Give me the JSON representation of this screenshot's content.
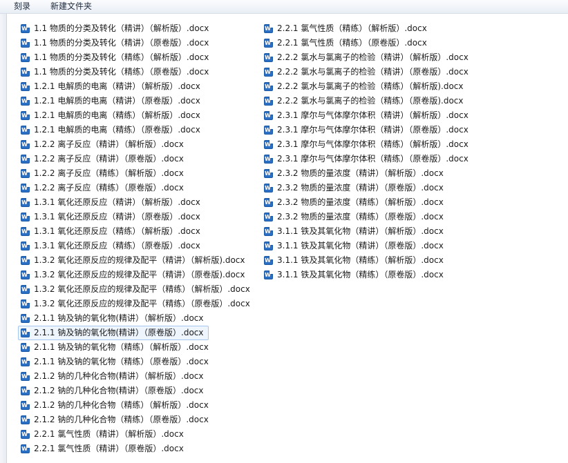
{
  "toolbar": {
    "burn_label": "刻录",
    "new_folder_label": "新建文件夹"
  },
  "icon": {
    "glyph": "W",
    "name": "word-doc-icon",
    "color": "#2b6fc4"
  },
  "selected_file": "2.1.1 钠及钠的氧化物(精讲）（原卷版）.docx",
  "columns": [
    [
      "1.1 物质的分类及转化（精讲）（解析版）.docx",
      "1.1 物质的分类及转化（精讲）（原卷版）.docx",
      "1.1 物质的分类及转化（精练）（解析版）.docx",
      "1.1 物质的分类及转化（精练）（原卷版）.docx",
      "1.2.1 电解质的电离（精讲）（解析版）.docx",
      "1.2.1 电解质的电离（精讲）（原卷版）.docx",
      "1.2.1 电解质的电离（精练）（解析版）.docx",
      "1.2.1 电解质的电离（精练）（原卷版）.docx",
      "1.2.2 离子反应（精讲）（解析版）.docx",
      "1.2.2 离子反应（精讲）（原卷版）.docx",
      "1.2.2 离子反应（精练）（解析版）.docx",
      "1.2.2 离子反应（精练）（原卷版）.docx",
      "1.3.1 氧化还原反应（精讲）（解析版）.docx",
      "1.3.1 氧化还原反应（精讲）（原卷版）.docx",
      "1.3.1 氧化还原反应（精练）（解析版）.docx",
      "1.3.1 氧化还原反应（精练）（原卷版）.docx",
      "1.3.2 氧化还原反应的规律及配平（精讲）（解析版).docx",
      "1.3.2 氧化还原反应的规律及配平（精讲）（原卷版).docx",
      "1.3.2 氧化还原反应的规律及配平（精练）（解析版）.docx",
      "1.3.2 氧化还原反应的规律及配平（精练）（原卷版）.docx",
      "2.1.1 钠及钠的氧化物(精讲）（解析版）.docx",
      "2.1.1 钠及钠的氧化物(精讲）（原卷版）.docx",
      "2.1.1 钠及钠的氧化物（精练）（解析版）.docx",
      "2.1.1 钠及钠的氧化物（精练）（原卷版）.docx",
      "2.1.2 钠的几种化合物(精讲）（解析版）.docx",
      "2.1.2 钠的几种化合物(精讲）（原卷版）.docx",
      "2.1.2 钠的几种化合物（精练）（解析版）.docx",
      "2.1.2 钠的几种化合物（精练）（原卷版）.docx",
      "2.2.1 氯气性质（精讲）（解析版）.docx",
      "2.2.1 氯气性质（精讲）（原卷版）.docx"
    ],
    [
      "2.2.1 氯气性质（精练）（解析版）.docx",
      "2.2.1 氯气性质（精练）（原卷版）.docx",
      "2.2.2 氯水与氯离子的检验（精讲）（解析版）.docx",
      "2.2.2 氯水与氯离子的检验（精讲）（原卷版）.docx",
      "2.2.2 氯水与氯离子的检验（精练）（解析版).docx",
      "2.2.2 氯水与氯离子的检验（精练）（原卷版).docx",
      "2.3.1 摩尔与气体摩尔体积（精讲）（解析版）.docx",
      "2.3.1 摩尔与气体摩尔体积（精讲）（原卷版）.docx",
      "2.3.1 摩尔与气体摩尔体积（精练）（解析版）.docx",
      "2.3.1 摩尔与气体摩尔体积（精练）（原卷版）.docx",
      "2.3.2 物质的量浓度（精讲）（解析版）.docx",
      "2.3.2 物质的量浓度（精讲）（原卷版）.docx",
      "2.3.2 物质的量浓度（精练）（解析版）.docx",
      "2.3.2 物质的量浓度（精练）（原卷版）.docx",
      "3.1.1 铁及其氧化物（精讲）（解析版）.docx",
      "3.1.1 铁及其氧化物（精讲）（原卷版）.docx",
      "3.1.1 铁及其氧化物（精练）（解析版）.docx",
      "3.1.1 铁及其氧化物（精练）（原卷版）.docx"
    ]
  ]
}
